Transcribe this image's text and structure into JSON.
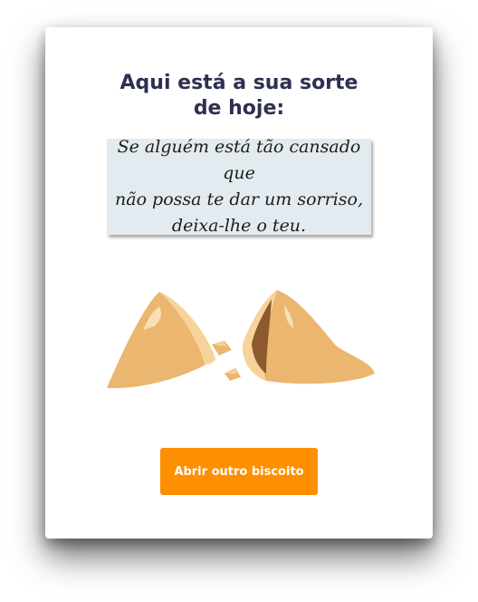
{
  "card": {
    "title_line1": "Aqui está a sua sorte",
    "title_line2": "de hoje:",
    "fortune_line1": "Se alguém está tão cansado que",
    "fortune_line2": "não possa te dar um sorriso,",
    "fortune_line3": "deixa-lhe o teu.",
    "button_label": "Abrir outro biscoito"
  },
  "colors": {
    "title": "#2e3051",
    "fortune_background": "#e3ebf0",
    "button": "#fd8f00",
    "cookie": "#ebb66f"
  },
  "icons": {
    "illustration": "broken-fortune-cookie-icon"
  }
}
